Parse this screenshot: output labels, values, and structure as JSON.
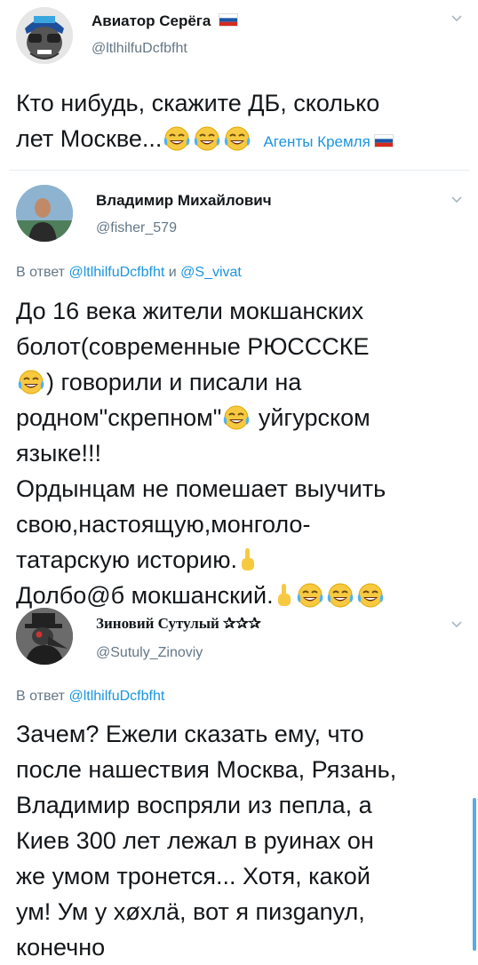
{
  "tweets": [
    {
      "name": "Авиатор Серёга",
      "handle": "@ltlhilfuDcfbfht",
      "lines": [
        "Кто нибудь, скажите ДБ, сколько",
        "лет Москве..."
      ],
      "emoji_count": 3,
      "tag": "Агенты Кремля"
    },
    {
      "name": "Владимир Михайлович",
      "handle": "@fisher_579",
      "reply_prefix": "В ответ",
      "reply_handle_1": "@ltlhilfuDcfbfht",
      "reply_and": "и",
      "reply_handle_2": "@S_vivat",
      "lines": [
        "До 16 века жители мокшанских",
        "болот(современные РЮСССКЕ",
        ") говорили и писали на",
        "родном\"скрепном\"",
        "уйгурском",
        "языке!!!",
        "Ордынцам не помешает выучить",
        "свою,настоящую,монголо-",
        "татарскую историю.",
        "Долбо@б мокшанский."
      ]
    },
    {
      "name": "Зиновий Сутулый ✰✰✰",
      "handle": "@Sutuly_Zinoviy",
      "reply_prefix": "В ответ",
      "reply_handle_1": "@ltlhilfuDcfbfht",
      "lines": [
        "Зачем? Ежели сказать ему, что",
        "после нашествия Москва, Рязань,",
        "Владимир воспряли из пепла, а",
        "Киев 300 лет лежал в руинах он",
        "же умом тронется... Хотя, какой",
        "ум! Ум у хøхлä, вот я пизganул,",
        "конечно"
      ]
    }
  ],
  "icons": {
    "emoji": "face-with-tears-of-joy-icon",
    "hand": "pointing-finger-icon",
    "flag": "russian-flag-icon",
    "more": "chevron-down-icon"
  },
  "colors": {
    "link": "#1b95e0",
    "secondary": "#657786",
    "text": "#14171a",
    "emoji": "#f7c940"
  }
}
